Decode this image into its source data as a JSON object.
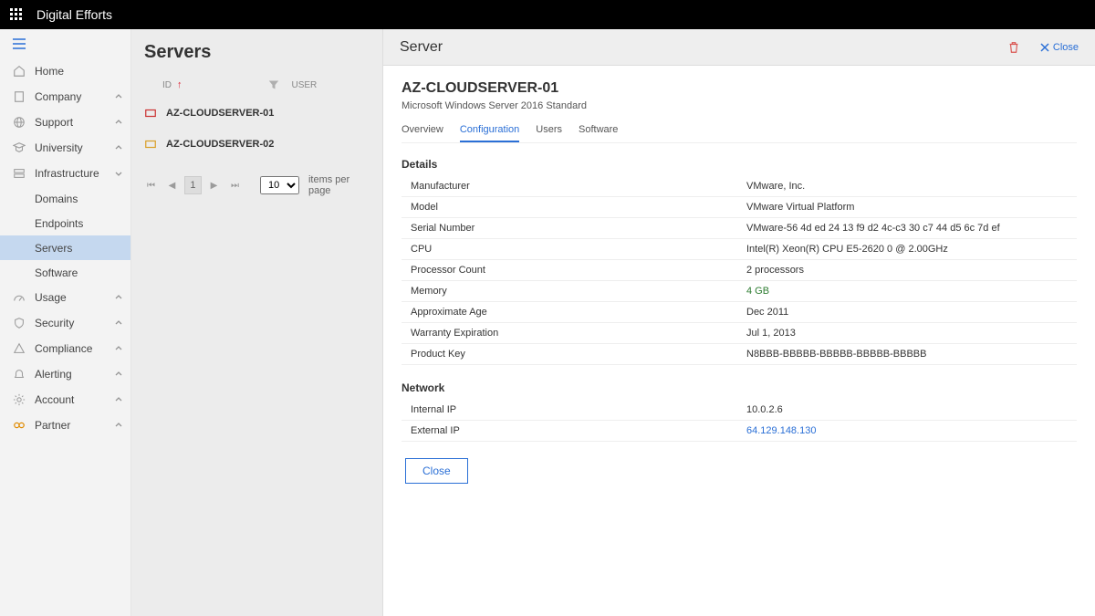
{
  "brand": "Digital Efforts",
  "nav": {
    "home": "Home",
    "company": "Company",
    "support": "Support",
    "university": "University",
    "infrastructure": "Infrastructure",
    "infra_children": {
      "domains": "Domains",
      "endpoints": "Endpoints",
      "servers": "Servers",
      "software": "Software"
    },
    "usage": "Usage",
    "security": "Security",
    "compliance": "Compliance",
    "alerting": "Alerting",
    "account": "Account",
    "partner": "Partner"
  },
  "servers": {
    "heading": "Servers",
    "id_label": "ID",
    "user_label": "USER",
    "rows": [
      {
        "name": "AZ-CLOUDSERVER-01"
      },
      {
        "name": "AZ-CLOUDSERVER-02"
      }
    ],
    "page": "1",
    "page_size": "10",
    "ipp_label": "items per page"
  },
  "detail": {
    "pane_title": "Server",
    "close_label": "Close",
    "name": "AZ-CLOUDSERVER-01",
    "subtitle": "Microsoft Windows Server 2016 Standard",
    "tabs": {
      "overview": "Overview",
      "configuration": "Configuration",
      "users": "Users",
      "software": "Software"
    },
    "details_title": "Details",
    "details": {
      "manufacturer_k": "Manufacturer",
      "manufacturer_v": "VMware, Inc.",
      "model_k": "Model",
      "model_v": "VMware Virtual Platform",
      "serial_k": "Serial Number",
      "serial_v": "VMware-56 4d ed 24 13 f9 d2 4c-c3 30 c7 44 d5 6c 7d ef",
      "cpu_k": "CPU",
      "cpu_v": "Intel(R) Xeon(R) CPU E5-2620 0 @ 2.00GHz",
      "proc_k": "Processor Count",
      "proc_v": "2 processors",
      "mem_k": "Memory",
      "mem_v": "4 GB",
      "age_k": "Approximate Age",
      "age_v": "Dec 2011",
      "warranty_k": "Warranty Expiration",
      "warranty_v": "Jul 1, 2013",
      "pkey_k": "Product Key",
      "pkey_v": "N8BBB-BBBBB-BBBBB-BBBBB-BBBBB"
    },
    "network_title": "Network",
    "network": {
      "int_k": "Internal IP",
      "int_v": "10.0.2.6",
      "ext_k": "External IP",
      "ext_v": "64.129.148.130"
    },
    "close_btn": "Close"
  }
}
